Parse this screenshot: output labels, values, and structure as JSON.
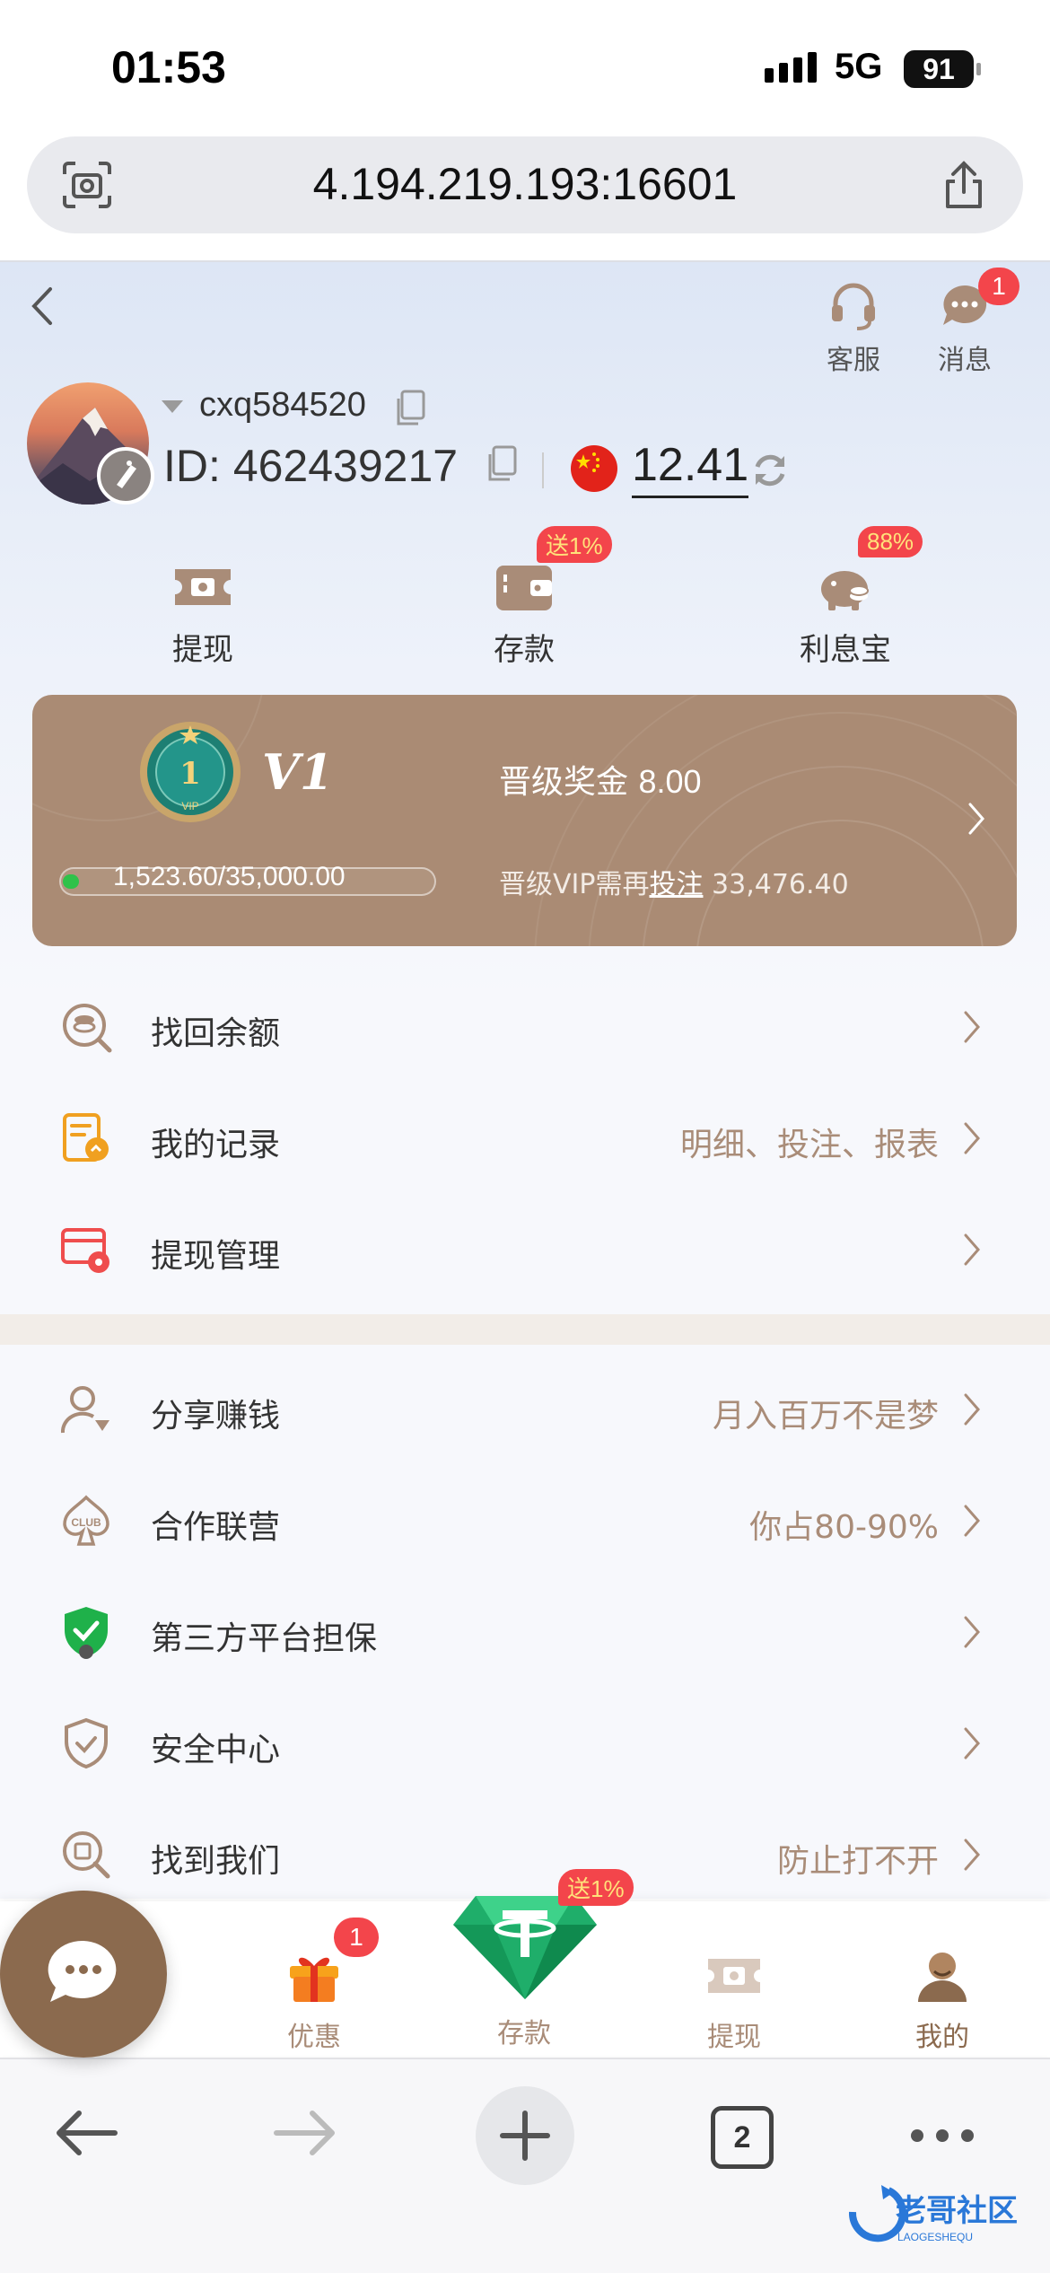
{
  "status_bar": {
    "time": "01:53",
    "network": "5G",
    "battery": "91"
  },
  "browser": {
    "url": "4.194.219.193:16601",
    "tab_count": "2"
  },
  "header": {
    "service_label": "客服",
    "messages_label": "消息",
    "messages_badge": "1"
  },
  "profile": {
    "username": "cxq584520",
    "id_label": "ID:",
    "id_value": "462439217",
    "balance": "12.41"
  },
  "quick_actions": [
    {
      "label": "提现",
      "icon": "withdraw-ticket-icon",
      "tag": ""
    },
    {
      "label": "存款",
      "icon": "wallet-icon",
      "tag": "送1%"
    },
    {
      "label": "利息宝",
      "icon": "piggy-bank-icon",
      "tag": "88%"
    }
  ],
  "vip": {
    "level": "V1",
    "medal_number": "1",
    "medal_text": "VIP",
    "bonus_label": "晋级奖金",
    "bonus_value": "8.00",
    "progress_text": "1,523.60/35,000.00",
    "progress_fraction": 0.0435,
    "need_prefix": "晋级VIP需再",
    "need_link": "投注",
    "need_value": "33,476.40"
  },
  "menu_group1": [
    {
      "label": "找回余额",
      "right": "",
      "icon": "coins-search-icon"
    },
    {
      "label": "我的记录",
      "right": "明细、投注、报表",
      "icon": "record-icon"
    },
    {
      "label": "提现管理",
      "right": "",
      "icon": "card-settings-icon"
    }
  ],
  "menu_group2": [
    {
      "label": "分享赚钱",
      "right": "月入百万不是梦",
      "icon": "share-user-icon"
    },
    {
      "label": "合作联营",
      "right": "你占80-90%",
      "icon": "club-icon"
    },
    {
      "label": "第三方平台担保",
      "right": "",
      "icon": "guarantee-shield-icon"
    },
    {
      "label": "安全中心",
      "right": "",
      "icon": "security-shield-icon"
    },
    {
      "label": "找到我们",
      "right": "防止打不开",
      "icon": "find-us-icon"
    }
  ],
  "tabbar": {
    "items": [
      {
        "label": "优惠",
        "badge": "1"
      },
      {
        "label": "存款",
        "tag": "送1%"
      },
      {
        "label": "提现"
      },
      {
        "label": "我的"
      }
    ]
  },
  "watermark": {
    "text": "老哥社区",
    "sub": "LAOGESHEQU"
  },
  "colors": {
    "accent": "#a98c78",
    "vip_card": "#aa8b74",
    "badge": "#f3454b",
    "chat_button": "#8b6a4e"
  }
}
